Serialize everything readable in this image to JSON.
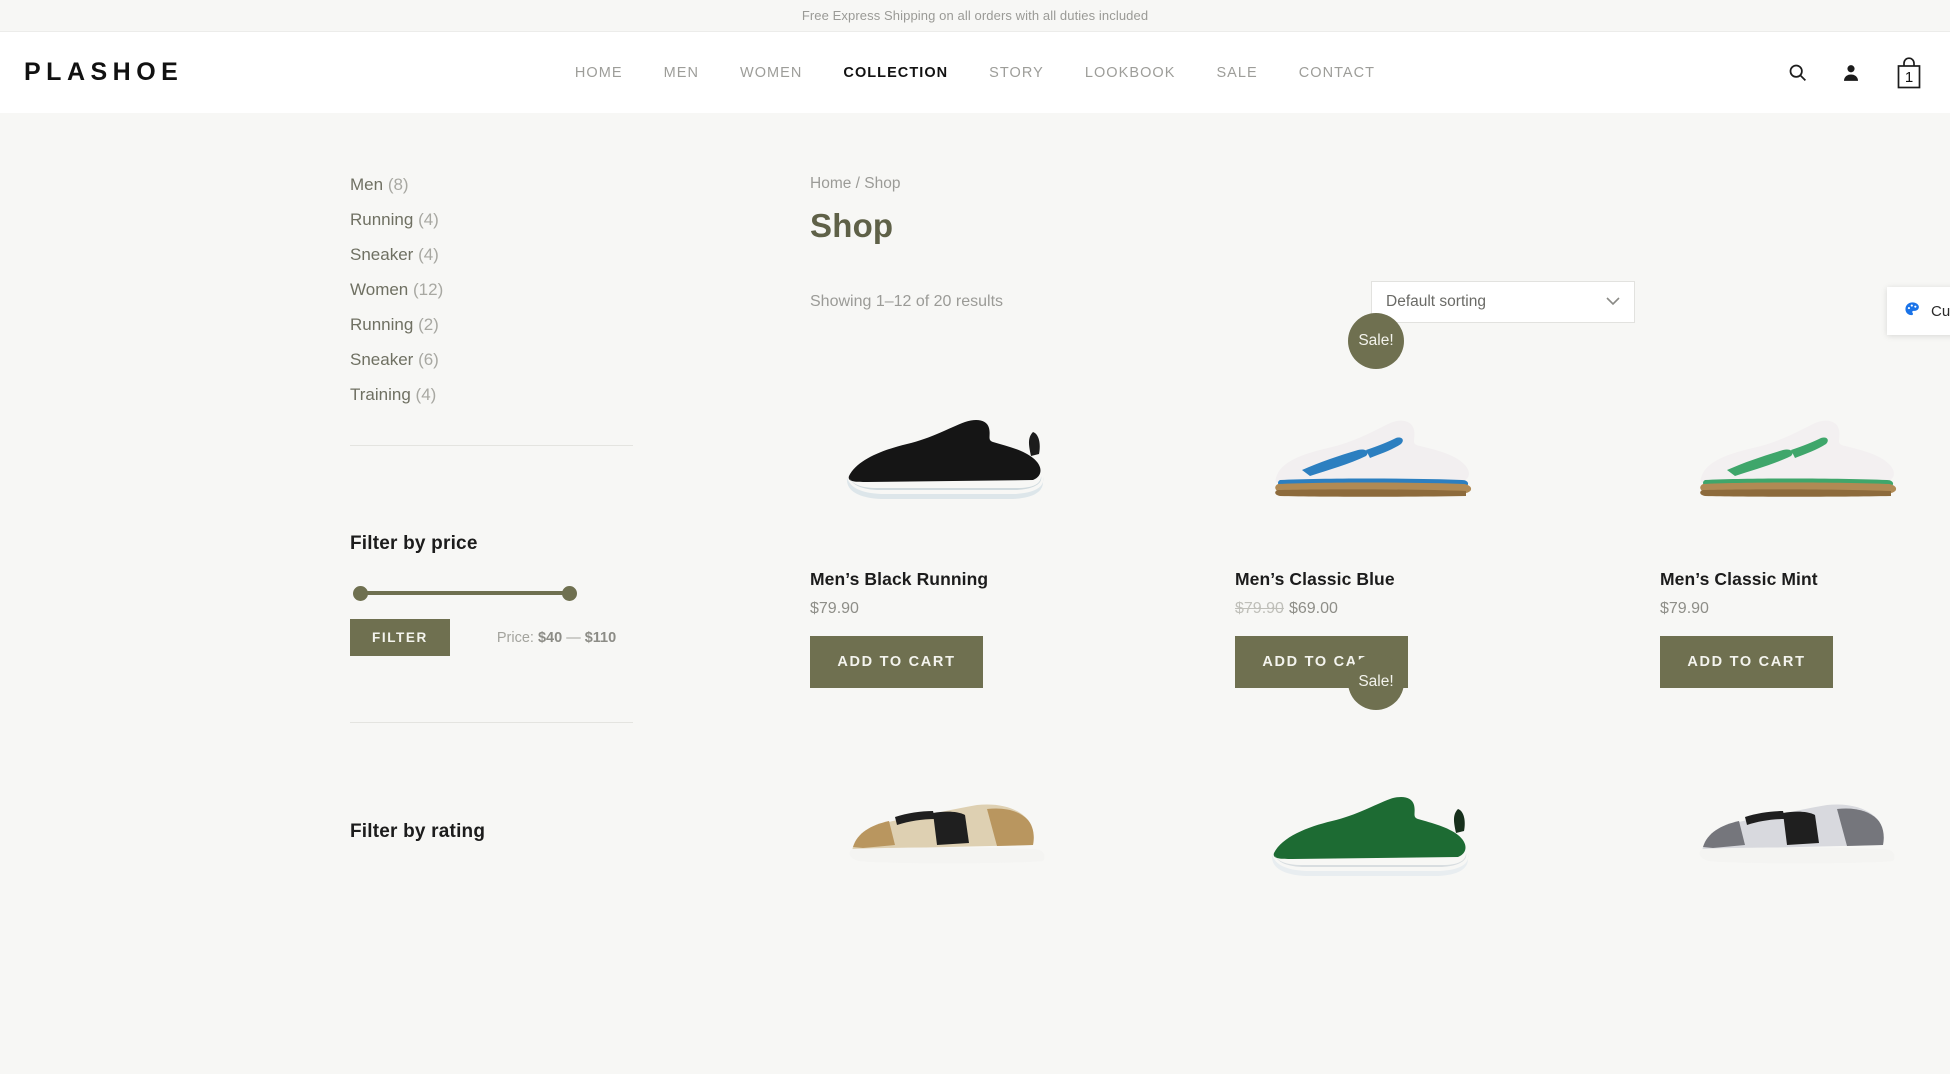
{
  "announcement": {
    "text": "Free Express Shipping on all orders with all duties included"
  },
  "header": {
    "logo": "PLASHOE",
    "nav": [
      {
        "label": "HOME",
        "active": false
      },
      {
        "label": "MEN",
        "active": false
      },
      {
        "label": "WOMEN",
        "active": false
      },
      {
        "label": "COLLECTION",
        "active": true
      },
      {
        "label": "STORY",
        "active": false
      },
      {
        "label": "LOOKBOOK",
        "active": false
      },
      {
        "label": "SALE",
        "active": false
      },
      {
        "label": "CONTACT",
        "active": false
      }
    ],
    "icons": {
      "search": "search-icon",
      "account": "user-icon",
      "cart": "cart-icon"
    },
    "cart_count": "1"
  },
  "sidebar": {
    "categories": [
      {
        "label": "Men",
        "count": "(8)"
      },
      {
        "label": "Running",
        "count": "(4)"
      },
      {
        "label": "Sneaker",
        "count": "(4)"
      },
      {
        "label": "Women",
        "count": "(12)"
      },
      {
        "label": "Running",
        "count": "(2)"
      },
      {
        "label": "Sneaker",
        "count": "(6)"
      },
      {
        "label": "Training",
        "count": "(4)"
      }
    ],
    "price_widget": {
      "title": "Filter by price",
      "button": "FILTER",
      "price_prefix": "Price:",
      "min": "$40",
      "separator": "—",
      "max": "$110"
    },
    "rating_widget": {
      "title": "Filter by rating"
    }
  },
  "main": {
    "breadcrumb": "Home / Shop",
    "title": "Shop",
    "result_count": "Showing 1–12 of 20 results",
    "sorting": {
      "selected": "Default sorting"
    },
    "sale_label": "Sale!",
    "add_to_cart": "ADD TO CART",
    "products": [
      {
        "title": "Men’s Black Running",
        "price": "$79.90",
        "sale": false,
        "old_price": "",
        "new_price": ""
      },
      {
        "title": "Men’s Classic Blue",
        "price": "",
        "sale": true,
        "old_price": "$79.90",
        "new_price": "$69.00"
      },
      {
        "title": "Men’s Classic Mint",
        "price": "$79.90",
        "sale": false,
        "old_price": "",
        "new_price": ""
      }
    ],
    "products_row2_sale": true
  },
  "customize": {
    "label": "Customize",
    "icon": "palette-icon",
    "color": "#1a73e8"
  },
  "colors": {
    "accent": "#6f7050",
    "title": "#5f6148",
    "muted": "#9b9b97"
  }
}
